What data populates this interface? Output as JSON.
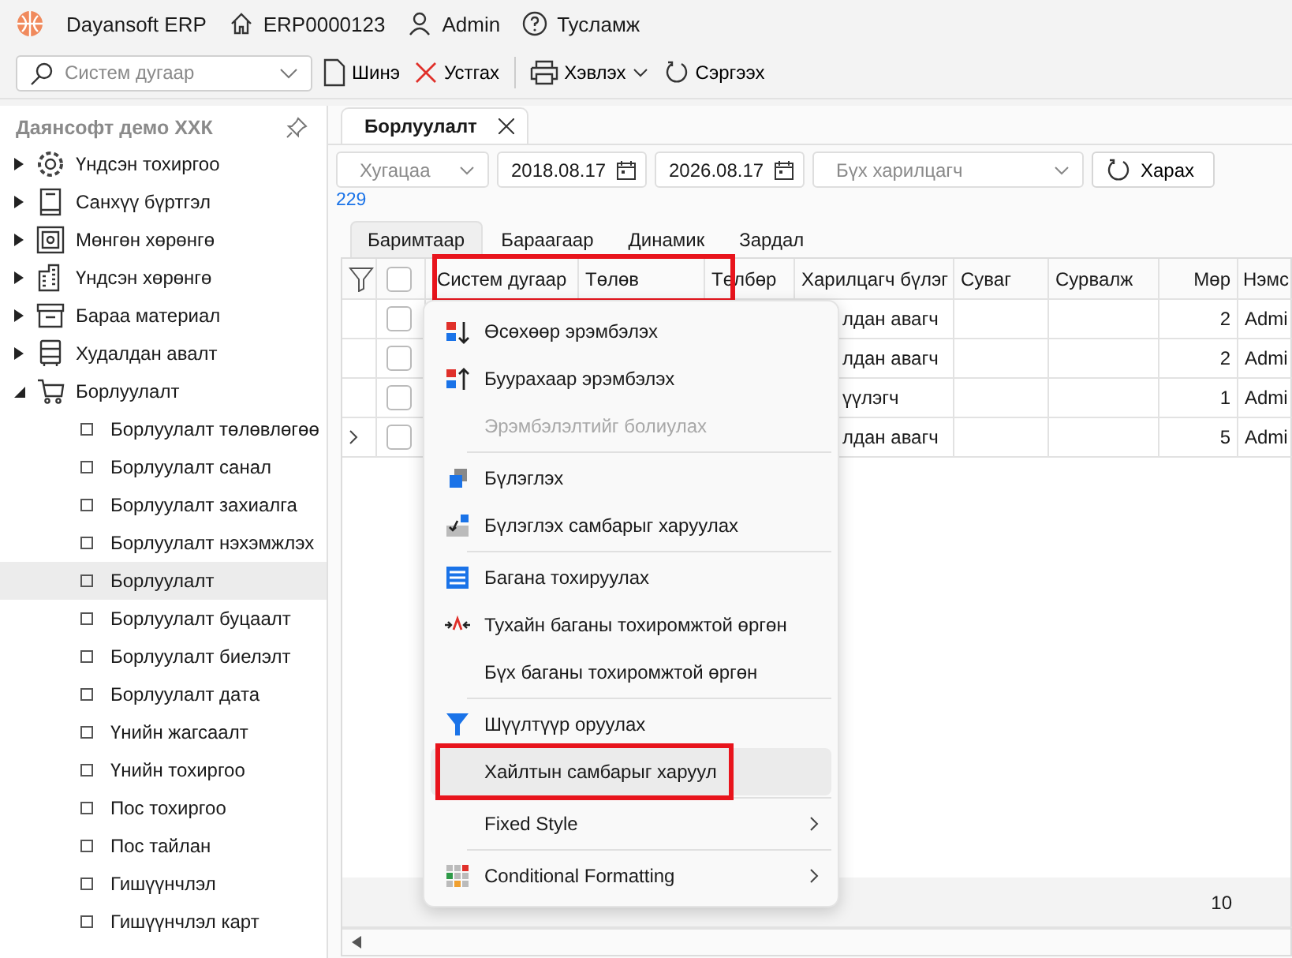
{
  "app_bar": {
    "app_name": "Dayansoft ERP",
    "document": "ERP0000123",
    "user": "Admin",
    "help": "Тусламж"
  },
  "toolbar": {
    "search": {
      "placeholder": "Систем дугаар"
    },
    "buttons": [
      {
        "kind": "new",
        "label": "Шинэ",
        "dropdown": false
      },
      {
        "kind": "delete",
        "label": "Устгах",
        "dropdown": false
      },
      {
        "kind": "print",
        "label": "Хэвлэх",
        "dropdown": true
      },
      {
        "kind": "refresh",
        "label": "Сэргээх",
        "dropdown": false
      }
    ]
  },
  "sidebar": {
    "title": "Даянсофт демо ХХК",
    "items": [
      {
        "kind": "gear",
        "label": "Үндсэн тохиргоо",
        "expanded": false
      },
      {
        "kind": "book",
        "label": "Санхүү бүртгэл",
        "expanded": false
      },
      {
        "kind": "safe",
        "label": "Мөнгөн хөрөнгө",
        "expanded": false
      },
      {
        "kind": "building",
        "label": "Үндсэн хөрөнгө",
        "expanded": false
      },
      {
        "kind": "box",
        "label": "Бараа материал",
        "expanded": false
      },
      {
        "kind": "cabinet",
        "label": "Худалдан авалт",
        "expanded": false
      },
      {
        "kind": "cart",
        "label": "Борлуулалт",
        "expanded": true,
        "children": [
          {
            "label": "Борлуулалт төлөвлөгөө",
            "selected": false
          },
          {
            "label": "Борлуулалт санал",
            "selected": false
          },
          {
            "label": "Борлуулалт захиалга",
            "selected": false
          },
          {
            "label": "Борлуулалт нэхэмжлэх",
            "selected": false
          },
          {
            "label": "Борлуулалт",
            "selected": true
          },
          {
            "label": "Борлуулалт буцаалт",
            "selected": false
          },
          {
            "label": "Борлуулалт биелэлт",
            "selected": false
          },
          {
            "label": "Борлуулалт дата",
            "selected": false
          },
          {
            "label": "Үнийн жагсаалт",
            "selected": false
          },
          {
            "label": "Үнийн тохиргоо",
            "selected": false
          },
          {
            "label": "Пос тохиргоо",
            "selected": false
          },
          {
            "label": "Пос тайлан",
            "selected": false
          },
          {
            "label": "Гишүүнчлэл",
            "selected": false
          },
          {
            "label": "Гишүүнчлэл карт",
            "selected": false
          }
        ]
      }
    ]
  },
  "tabs": [
    {
      "label": "Борлуулалт",
      "selected": true
    }
  ],
  "filters": {
    "period": {
      "placeholder": "Хугацаа"
    },
    "date_from": "2018.08.17",
    "date_to": "2026.08.17",
    "partner": {
      "placeholder": "Бүх харилцагч"
    },
    "view_button": "Харах"
  },
  "record_count": "229",
  "view_tabs": [
    {
      "label": "Баримтаар",
      "selected": true
    },
    {
      "label": "Бараагаар",
      "selected": false
    },
    {
      "label": "Динамик",
      "selected": false
    },
    {
      "label": "Зардал",
      "selected": false
    }
  ],
  "table": {
    "header_highlighted": true,
    "header_checked": false,
    "columns": [
      {
        "kind": "text",
        "label": "Систем дугаар"
      },
      {
        "kind": "text",
        "label": "Төлөв"
      },
      {
        "kind": "text",
        "label": "Төлбөр"
      },
      {
        "kind": "text",
        "label": "Харилцагч бүлэг"
      },
      {
        "kind": "text",
        "label": "Суваг"
      },
      {
        "kind": "text",
        "label": "Сурвалж"
      },
      {
        "kind": "number",
        "label": "Мөр"
      },
      {
        "kind": "text",
        "label": "Нэмс"
      }
    ],
    "rows": [
      {
        "expandable": false,
        "checked": false,
        "customer_group": "лдан авагч",
        "lines": "2",
        "added_by": "Admi"
      },
      {
        "expandable": false,
        "checked": false,
        "customer_group": "лдан авагч",
        "lines": "2",
        "added_by": "Admi"
      },
      {
        "expandable": false,
        "checked": false,
        "customer_group": "үүлэгч",
        "lines": "1",
        "added_by": "Admi"
      },
      {
        "expandable": true,
        "checked": false,
        "customer_group": "лдан авагч",
        "lines": "5",
        "added_by": "Admi"
      }
    ],
    "footer": {
      "lines_total": "10"
    }
  },
  "context_menu": {
    "items": [
      {
        "kind": "sort-asc",
        "label": "Өсөхөөр эрэмбэлэх",
        "disabled": false,
        "selected": false,
        "highlighted": false,
        "submenu": false
      },
      {
        "kind": "sort-desc",
        "label": "Буурахаар эрэмбэлэх",
        "disabled": false,
        "selected": false,
        "highlighted": false,
        "submenu": false
      },
      {
        "kind": "plain",
        "label": "Эрэмбэлэлтийг болиулах",
        "disabled": true,
        "selected": false,
        "highlighted": false,
        "submenu": false
      },
      {
        "kind": "separator"
      },
      {
        "kind": "group",
        "label": "Бүлэглэх",
        "disabled": false,
        "selected": false,
        "highlighted": false,
        "submenu": false
      },
      {
        "kind": "group-panel",
        "label": "Бүлэглэх самбарыг харуулах",
        "disabled": false,
        "selected": false,
        "highlighted": false,
        "submenu": false
      },
      {
        "kind": "separator"
      },
      {
        "kind": "columns",
        "label": "Багана тохируулах",
        "disabled": false,
        "selected": false,
        "highlighted": false,
        "submenu": false
      },
      {
        "kind": "fit-width",
        "label": "Тухайн баганы тохиромжтой өргөн",
        "disabled": false,
        "selected": false,
        "highlighted": false,
        "submenu": false
      },
      {
        "kind": "plain",
        "label": "Бүх баганы тохиромжтой өргөн",
        "disabled": false,
        "selected": false,
        "highlighted": false,
        "submenu": false
      },
      {
        "kind": "separator"
      },
      {
        "kind": "filter",
        "label": "Шүүлтүүр оруулах",
        "disabled": false,
        "selected": false,
        "highlighted": false,
        "submenu": false
      },
      {
        "kind": "plain",
        "label": "Хайлтын самбарыг харуул",
        "disabled": false,
        "selected": true,
        "highlighted": true,
        "submenu": false
      },
      {
        "kind": "separator"
      },
      {
        "kind": "plain",
        "label": "Fixed Style",
        "disabled": false,
        "selected": false,
        "highlighted": false,
        "submenu": true
      },
      {
        "kind": "separator"
      },
      {
        "kind": "conditional",
        "label": "Conditional Formatting",
        "disabled": false,
        "selected": false,
        "highlighted": false,
        "submenu": true
      }
    ]
  }
}
